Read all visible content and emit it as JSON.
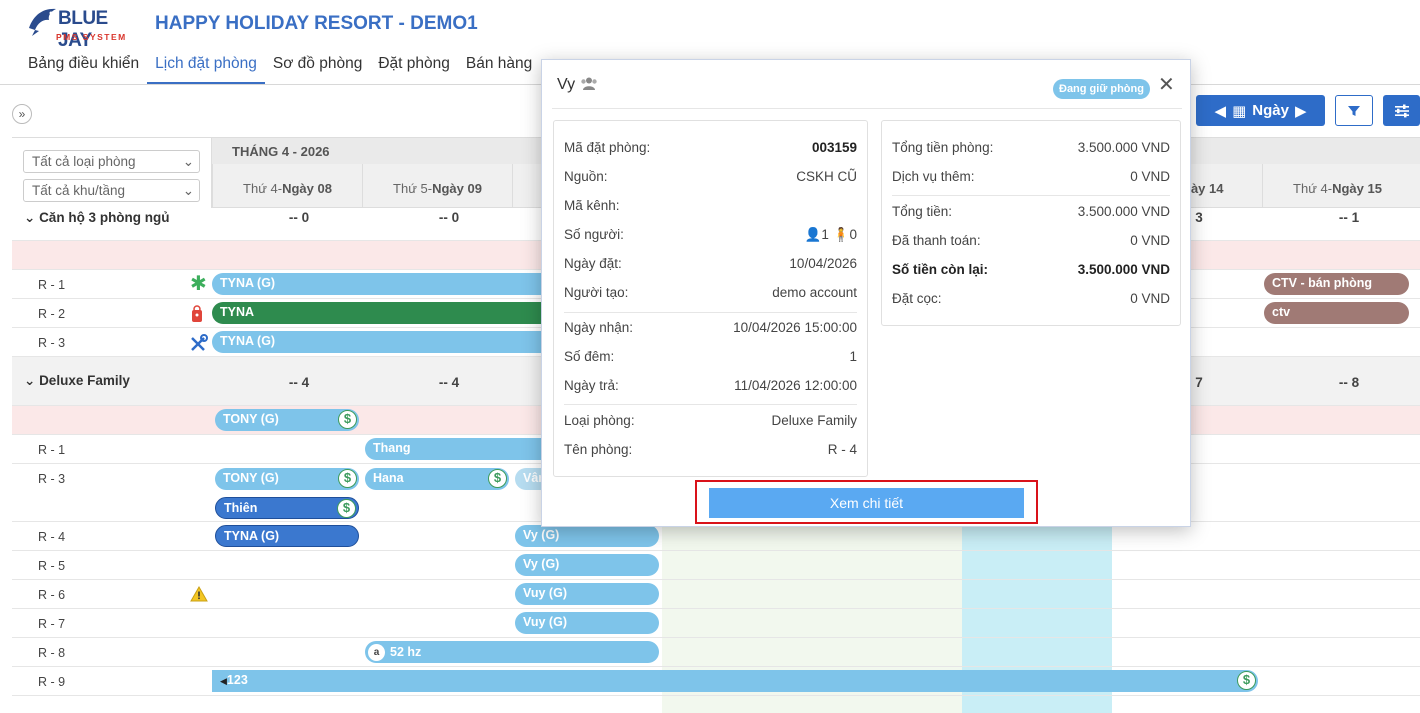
{
  "brand": {
    "name": "BLUE JAY",
    "sub": "PMS SYSTEM"
  },
  "hotel_title": "HAPPY HOLIDAY RESORT - DEMO1",
  "nav": [
    "Bảng điều khiển",
    "Lịch đặt phòng",
    "Sơ đồ phòng",
    "Đặt phòng",
    "Bán hàng"
  ],
  "toolbar": {
    "day_label": "Ngày"
  },
  "filters": {
    "room_type": "Tất cả loại phòng",
    "area": "Tất cả khu/tầng"
  },
  "calendar": {
    "month": "THÁNG 4 - 2026",
    "days": [
      {
        "weekday": "Thứ 4-",
        "day": "Ngày 08"
      },
      {
        "weekday": "Thứ 5-",
        "day": "Ngày 09"
      },
      {
        "weekday": "",
        "day": ""
      },
      {
        "weekday": "",
        "day": ""
      },
      {
        "weekday": "",
        "day": ""
      },
      {
        "weekday": "",
        "day": ""
      },
      {
        "weekday": "",
        "day": "gày 14"
      },
      {
        "weekday": "Thứ 4-",
        "day": "Ngày 15"
      }
    ],
    "groups": [
      {
        "name": "Căn hộ 3 phòng ngủ",
        "counts": [
          "-- 0",
          "-- 0",
          "3",
          "-- 1"
        ]
      },
      {
        "name": "Deluxe Family",
        "counts": [
          "-- 4",
          "-- 4",
          "7",
          "-- 8"
        ]
      }
    ],
    "rooms": [
      "R - 1",
      "R - 2",
      "R - 3",
      "R - 1",
      "R - 3",
      "R - 4",
      "R - 5",
      "R - 6",
      "R - 7",
      "R - 8",
      "R - 9"
    ],
    "bookings": [
      "TYNA (G)",
      "TYNA",
      "TYNA (G)",
      "CTV - bán phòng",
      "ctv",
      "TONY (G)",
      "Thang",
      "TONY (G)",
      "Hana",
      "Vân",
      "Thiên",
      "TYNA (G)",
      "Vy (G)",
      "Vy (G)",
      "Vuy (G)",
      "Vuy (G)",
      "52 hz",
      "123"
    ]
  },
  "modal": {
    "guest": "Vy",
    "status": "Đang giữ phòng",
    "left": {
      "booking_code_label": "Mã đặt phòng:",
      "booking_code": "003159",
      "source_label": "Nguồn:",
      "source": "CSKH CŨ",
      "channel_label": "Mã kênh:",
      "channel": "",
      "people_label": "Số người:",
      "adults": "1",
      "children": "0",
      "booked_label": "Ngày đặt:",
      "booked": "10/04/2026",
      "creator_label": "Người tạo:",
      "creator": "demo account",
      "checkin_label": "Ngày nhận:",
      "checkin": "10/04/2026 15:00:00",
      "nights_label": "Số đêm:",
      "nights": "1",
      "checkout_label": "Ngày trả:",
      "checkout": "11/04/2026 12:00:00",
      "room_type_label": "Loại phòng:",
      "room_type": "Deluxe Family",
      "room_name_label": "Tên phòng:",
      "room_name": "R - 4"
    },
    "right": {
      "room_total_label": "Tổng tiền phòng:",
      "room_total": "3.500.000 VND",
      "service_label": "Dịch vụ thêm:",
      "service": "0 VND",
      "total_label": "Tổng tiền:",
      "total": "3.500.000 VND",
      "paid_label": "Đã thanh toán:",
      "paid": "0 VND",
      "remaining_label": "Số tiền còn lại:",
      "remaining": "3.500.000 VND",
      "deposit_label": "Đặt cọc:",
      "deposit": "0 VND"
    },
    "detail_button": "Xem chi tiết"
  }
}
